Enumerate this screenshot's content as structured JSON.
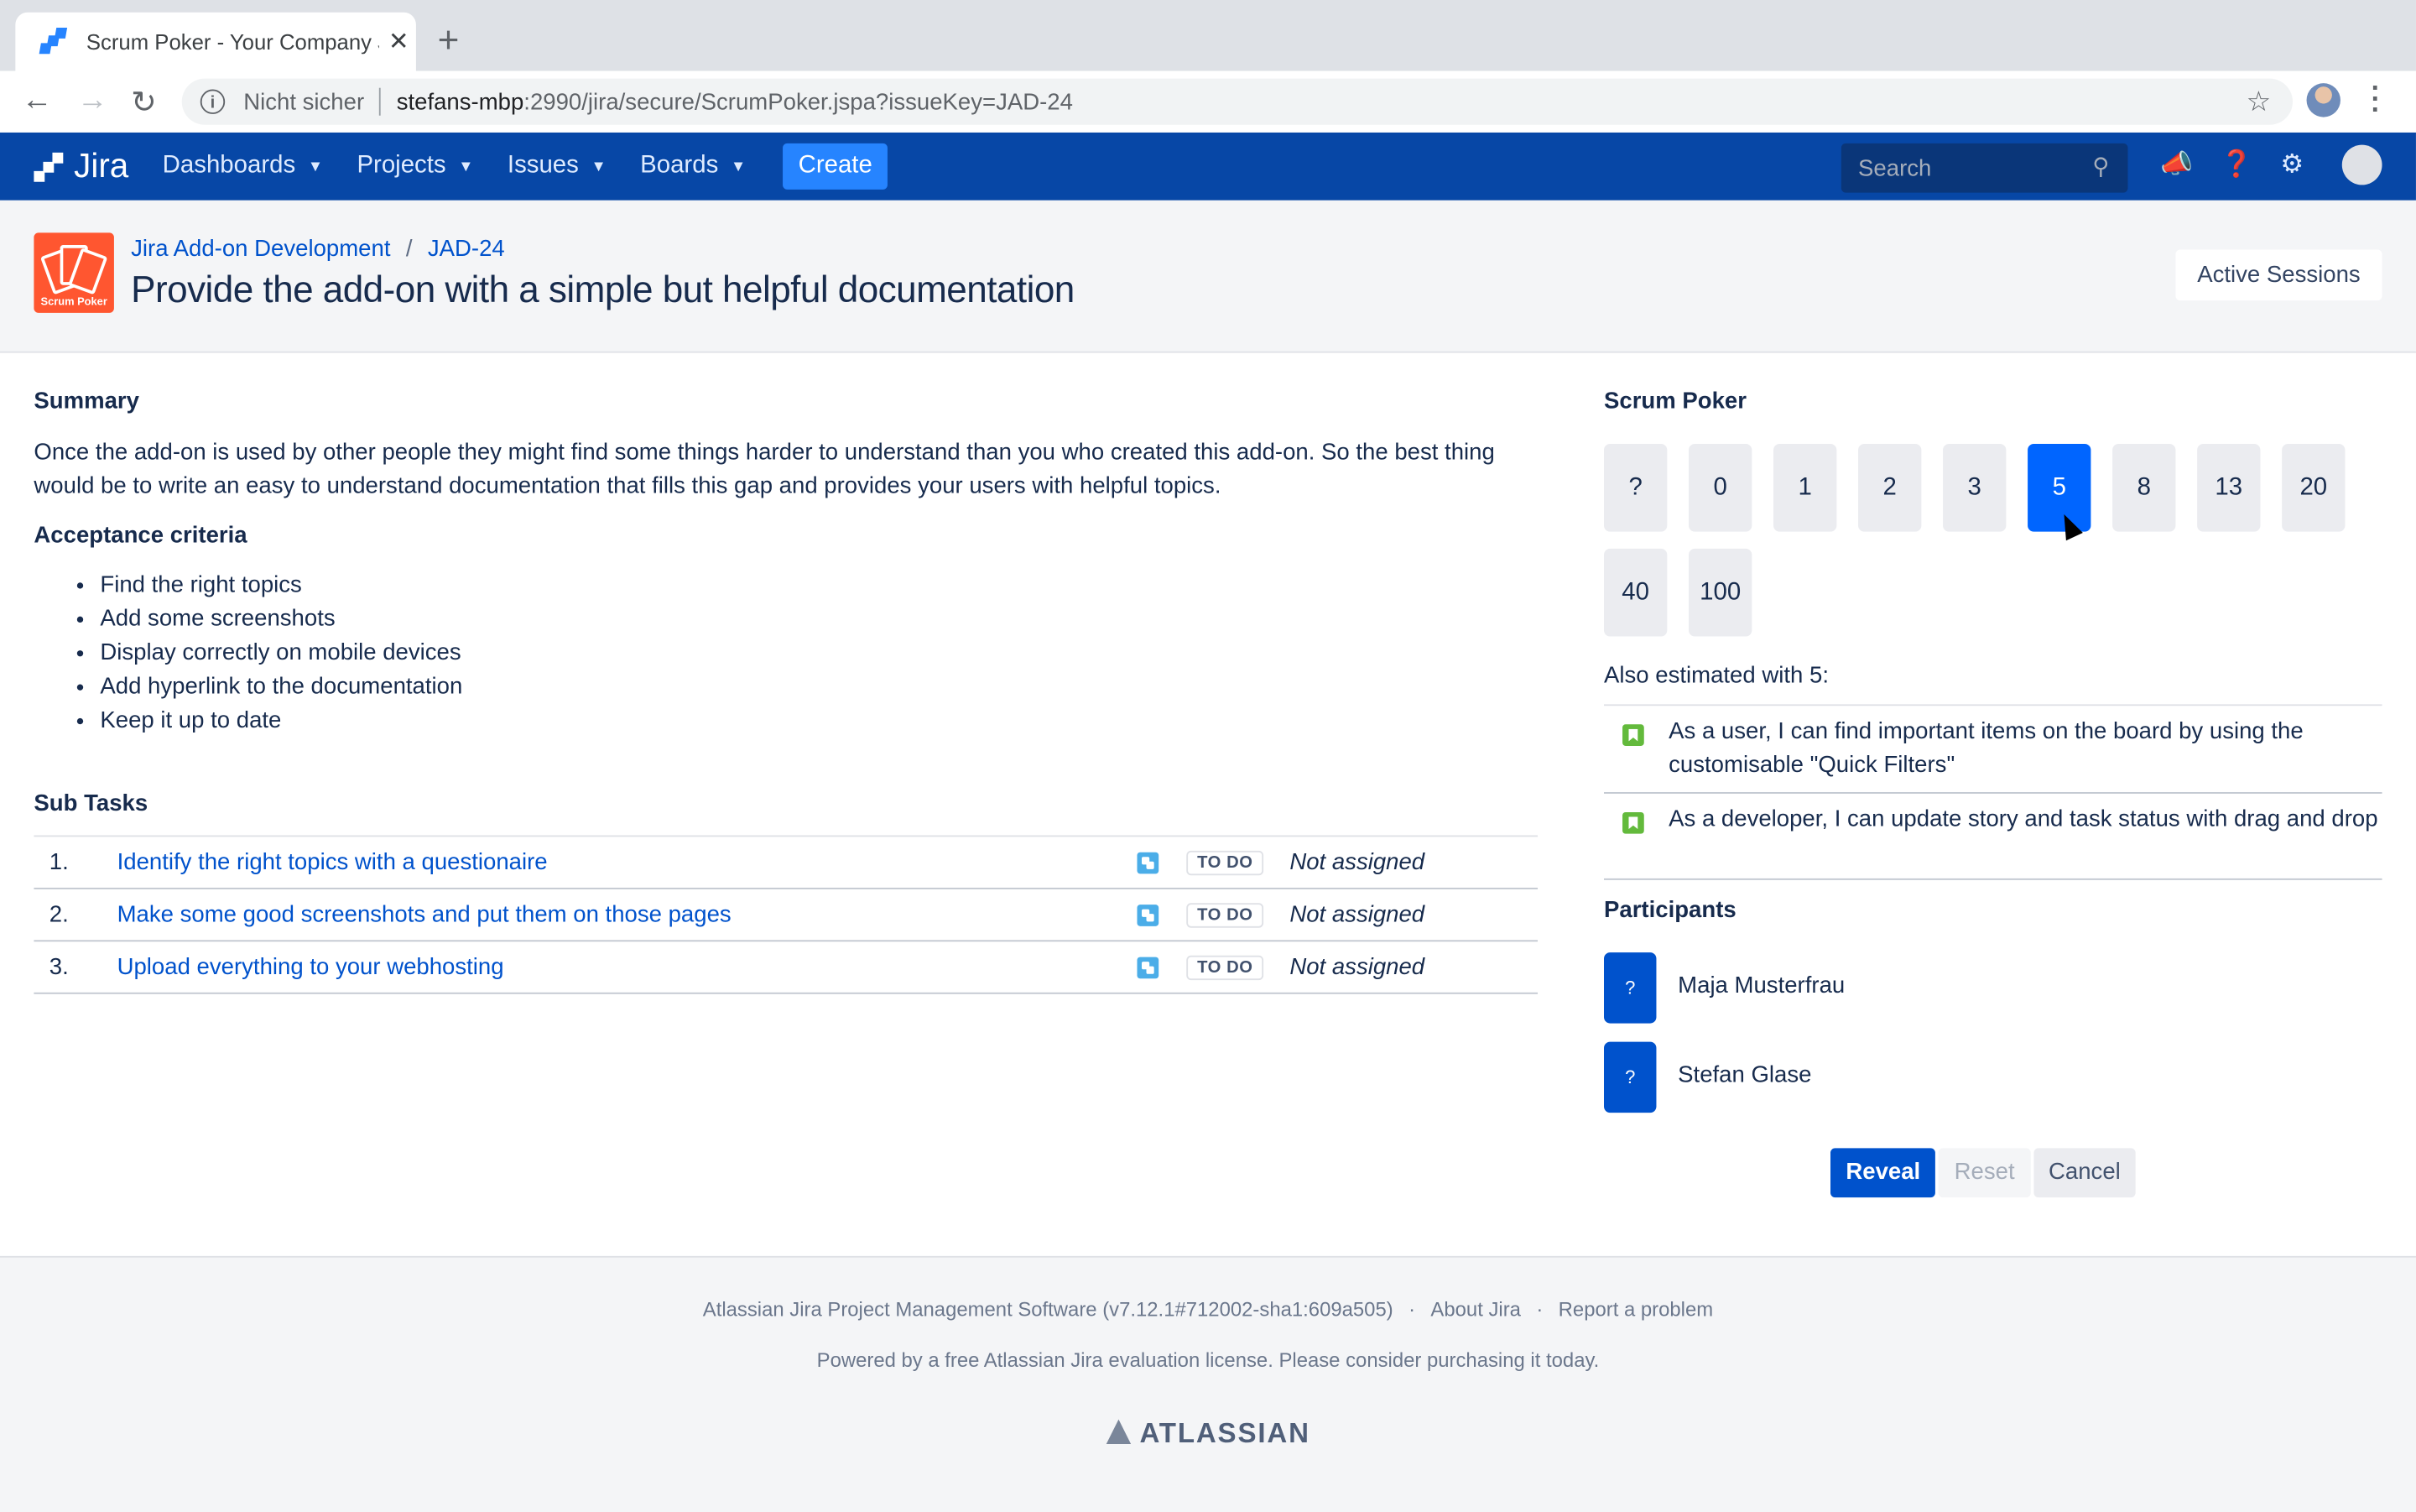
{
  "browser": {
    "tab_title": "Scrum Poker - Your Company J",
    "security_label": "Nicht sicher",
    "url_host": "stefans-mbp",
    "url_path": ":2990/jira/secure/ScrumPoker.jspa?issueKey=JAD-24"
  },
  "nav": {
    "logo_text": "Jira",
    "menus": [
      "Dashboards",
      "Projects",
      "Issues",
      "Boards"
    ],
    "create_label": "Create",
    "search_placeholder": "Search"
  },
  "issue": {
    "project": "Jira Add-on Development",
    "key": "JAD-24",
    "title": "Provide the add-on with a simple but helpful documentation",
    "logo_label": "Scrum Poker",
    "active_sessions_label": "Active Sessions"
  },
  "summary": {
    "heading": "Summary",
    "text": "Once the add-on is used by other people they might find some things harder to understand than you who created this add-on. So the best thing would be to write an easy to understand documentation that fills this gap and provides your users with helpful topics."
  },
  "acceptance": {
    "heading": "Acceptance criteria",
    "items": [
      "Find the right topics",
      "Add some screenshots",
      "Display correctly on mobile devices",
      "Add hyperlink to the documentation",
      "Keep it up to date"
    ]
  },
  "subtasks": {
    "heading": "Sub Tasks",
    "rows": [
      {
        "num": "1.",
        "title": "Identify the right topics with a questionaire",
        "status": "TO DO",
        "assignee": "Not assigned"
      },
      {
        "num": "2.",
        "title": "Make some good screenshots and put them on those pages",
        "status": "TO DO",
        "assignee": "Not assigned"
      },
      {
        "num": "3.",
        "title": "Upload everything to your webhosting",
        "status": "TO DO",
        "assignee": "Not assigned"
      }
    ]
  },
  "poker": {
    "heading": "Scrum Poker",
    "cards": [
      "?",
      "0",
      "1",
      "2",
      "3",
      "5",
      "8",
      "13",
      "20",
      "40",
      "100"
    ],
    "selected": "5",
    "also_label": "Also estimated with 5:",
    "also": [
      "As a user, I can find important items on the board by using the customisable \"Quick Filters\"",
      "As a developer, I can update story and task status with drag and drop"
    ],
    "participants_heading": "Participants",
    "participants": [
      {
        "name": "Maja Musterfrau",
        "vote": "?"
      },
      {
        "name": "Stefan Glase",
        "vote": "?"
      }
    ],
    "reveal_label": "Reveal",
    "reset_label": "Reset",
    "cancel_label": "Cancel"
  },
  "footer": {
    "version": "Atlassian Jira Project Management Software (v7.12.1#712002-sha1:609a505)",
    "about": "About Jira",
    "report": "Report a problem",
    "license": "Powered by a free Atlassian Jira evaluation license. Please consider purchasing it today.",
    "brand": "ATLASSIAN"
  },
  "colors": {
    "nav": "#0747a6",
    "primary": "#0052cc",
    "selected_card": "#0065ff",
    "logo": "#ff5630",
    "story": "#63ba3c",
    "subtask": "#4bade8"
  }
}
